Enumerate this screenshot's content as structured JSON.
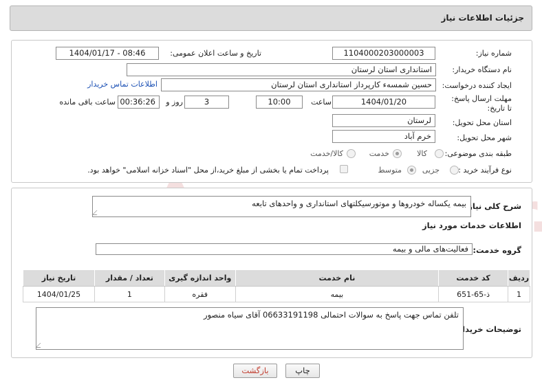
{
  "header": {
    "title": "جزئیات اطلاعات نیاز"
  },
  "form": {
    "need_number_label": "شماره نیاز:",
    "need_number": "1104000203000003",
    "announce_label": "تاریخ و ساعت اعلان عمومی:",
    "announce_value": "1404/01/17 - 08:46",
    "buyer_org_label": "نام دستگاه خریدار:",
    "buyer_org": "استانداری استان لرستان",
    "creator_label": "ایجاد کننده درخواست:",
    "creator": "حسین شمسه‌ء کارپرداز استانداری استان لرستان",
    "contact_link": "اطلاعات تماس خریدار",
    "deadline_label": "مهلت ارسال پاسخ: تا تاریخ:",
    "deadline_date": "1404/01/20",
    "time_label": "ساعت",
    "deadline_time": "10:00",
    "days_value": "3",
    "days_label": "روز و",
    "remaining_time": "00:36:26",
    "remaining_label": "ساعت باقی مانده",
    "province_label": "استان محل تحویل:",
    "province": "لرستان",
    "city_label": "شهر محل تحویل:",
    "city": "خرم آباد",
    "category_label": "طبقه بندی موضوعی:",
    "category_options": [
      "کالا",
      "خدمت",
      "کالا/خدمت"
    ],
    "category_selected": "خدمت",
    "process_label": "نوع فرآیند خرید :",
    "process_options": [
      "جزیی",
      "متوسط"
    ],
    "process_selected": "متوسط",
    "payment_note": "پرداخت تمام یا بخشی از مبلغ خرید،از محل \"اسناد خزانه اسلامی\" خواهد بود."
  },
  "detail": {
    "summary_label": "شرح کلی نیاز:",
    "summary": "بیمه یکساله خودروها و موتورسیکلتهای استانداری و واحدهای تابعه",
    "services_title": "اطلاعات خدمات مورد نیاز",
    "service_group_label": "گروه خدمت:",
    "service_group": "فعالیت‌های مالی و بیمه",
    "table": {
      "headers": [
        "ردیف",
        "کد خدمت",
        "نام خدمت",
        "واحد اندازه گیری",
        "تعداد / مقدار",
        "تاریخ نیاز"
      ],
      "rows": [
        [
          "1",
          "ذ-65-651",
          "بیمه",
          "فقره",
          "1",
          "1404/01/25"
        ]
      ]
    },
    "buyer_notes_label": "توضیحات خریدار:",
    "buyer_notes": "تلفن تماس جهت پاسخ به سوالات احتمالی 06633191198 آقای سیاه منصور"
  },
  "buttons": {
    "print": "چاپ",
    "back": "بازگشت"
  },
  "watermark": {
    "text": "AriaTender.neT"
  },
  "colors": {
    "link": "#1a4fb4",
    "header_bg": "#dcdcdc",
    "back_button_text": "#c0392b"
  }
}
